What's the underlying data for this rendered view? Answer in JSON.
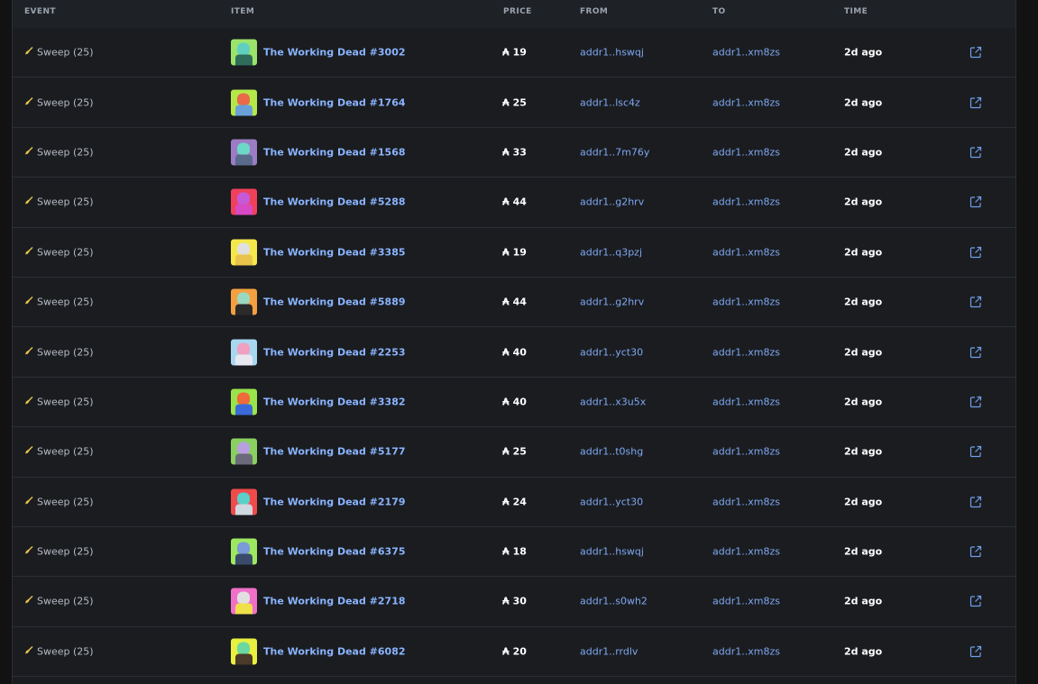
{
  "columns": {
    "event": "EVENT",
    "item": "ITEM",
    "price": "PRICE",
    "from": "FROM",
    "to": "TO",
    "time": "TIME"
  },
  "currency_symbol": "₳",
  "rows": [
    {
      "event": "Sweep (25)",
      "item": "The Working Dead #3002",
      "price": "19",
      "from": "addr1..hswqj",
      "to": "addr1..xm8zs",
      "time": "2d ago",
      "thumb_bg": "#9be36b",
      "thumb_head": "#5fd0c0",
      "thumb_body": "#2f6d5a"
    },
    {
      "event": "Sweep (25)",
      "item": "The Working Dead #1764",
      "price": "25",
      "from": "addr1..lsc4z",
      "to": "addr1..xm8zs",
      "time": "2d ago",
      "thumb_bg": "#b4e84a",
      "thumb_head": "#e86a4a",
      "thumb_body": "#6aa0d8"
    },
    {
      "event": "Sweep (25)",
      "item": "The Working Dead #1568",
      "price": "33",
      "from": "addr1..7m76y",
      "to": "addr1..xm8zs",
      "time": "2d ago",
      "thumb_bg": "#9c7cc4",
      "thumb_head": "#6ed8c8",
      "thumb_body": "#5a6a8a"
    },
    {
      "event": "Sweep (25)",
      "item": "The Working Dead #5288",
      "price": "44",
      "from": "addr1..g2hrv",
      "to": "addr1..xm8zs",
      "time": "2d ago",
      "thumb_bg": "#f0405a",
      "thumb_head": "#c45ad8",
      "thumb_body": "#d84ac4"
    },
    {
      "event": "Sweep (25)",
      "item": "The Working Dead #3385",
      "price": "19",
      "from": "addr1..q3pzj",
      "to": "addr1..xm8zs",
      "time": "2d ago",
      "thumb_bg": "#f4e84a",
      "thumb_head": "#e0e0e0",
      "thumb_body": "#e8c44a"
    },
    {
      "event": "Sweep (25)",
      "item": "The Working Dead #5889",
      "price": "44",
      "from": "addr1..g2hrv",
      "to": "addr1..xm8zs",
      "time": "2d ago",
      "thumb_bg": "#f4a040",
      "thumb_head": "#9ad8c0",
      "thumb_body": "#2a2a2a"
    },
    {
      "event": "Sweep (25)",
      "item": "The Working Dead #2253",
      "price": "40",
      "from": "addr1..yct30",
      "to": "addr1..xm8zs",
      "time": "2d ago",
      "thumb_bg": "#a8d8f0",
      "thumb_head": "#f0a0c0",
      "thumb_body": "#e8e8f0"
    },
    {
      "event": "Sweep (25)",
      "item": "The Working Dead #3382",
      "price": "40",
      "from": "addr1..x3u5x",
      "to": "addr1..xm8zs",
      "time": "2d ago",
      "thumb_bg": "#9be34a",
      "thumb_head": "#f06a3a",
      "thumb_body": "#3a6ad8"
    },
    {
      "event": "Sweep (25)",
      "item": "The Working Dead #5177",
      "price": "25",
      "from": "addr1..t0shg",
      "to": "addr1..xm8zs",
      "time": "2d ago",
      "thumb_bg": "#8ad060",
      "thumb_head": "#b8a0e0",
      "thumb_body": "#6a6a7a"
    },
    {
      "event": "Sweep (25)",
      "item": "The Working Dead #2179",
      "price": "24",
      "from": "addr1..yct30",
      "to": "addr1..xm8zs",
      "time": "2d ago",
      "thumb_bg": "#f04a4a",
      "thumb_head": "#5ad0c8",
      "thumb_body": "#d0d8e0"
    },
    {
      "event": "Sweep (25)",
      "item": "The Working Dead #6375",
      "price": "18",
      "from": "addr1..hswqj",
      "to": "addr1..xm8zs",
      "time": "2d ago",
      "thumb_bg": "#9ce860",
      "thumb_head": "#7a9ad8",
      "thumb_body": "#3a4a6a"
    },
    {
      "event": "Sweep (25)",
      "item": "The Working Dead #2718",
      "price": "30",
      "from": "addr1..s0wh2",
      "to": "addr1..xm8zs",
      "time": "2d ago",
      "thumb_bg": "#f070c8",
      "thumb_head": "#e0e0e0",
      "thumb_body": "#f0e04a"
    },
    {
      "event": "Sweep (25)",
      "item": "The Working Dead #6082",
      "price": "20",
      "from": "addr1..rrdlv",
      "to": "addr1..xm8zs",
      "time": "2d ago",
      "thumb_bg": "#e8f040",
      "thumb_head": "#6ad8a0",
      "thumb_body": "#4a3a2a"
    }
  ]
}
